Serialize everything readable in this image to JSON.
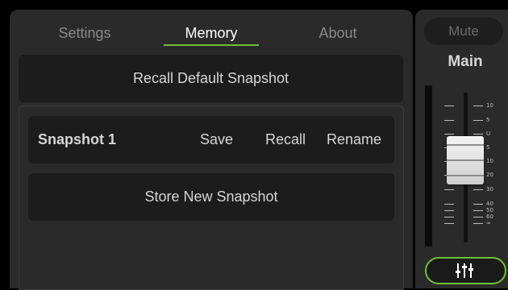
{
  "tabs": [
    {
      "label": "Settings",
      "active": false
    },
    {
      "label": "Memory",
      "active": true
    },
    {
      "label": "About",
      "active": false
    }
  ],
  "recall_default_label": "Recall Default Snapshot",
  "snapshots": [
    {
      "name": "Snapshot 1",
      "save_label": "Save",
      "recall_label": "Recall",
      "rename_label": "Rename"
    }
  ],
  "store_new_label": "Store New Snapshot",
  "channel": {
    "mute_label": "Mute",
    "name": "Main",
    "fader_scale": [
      "10",
      "5",
      "U",
      "5",
      "10",
      "20",
      "30",
      "40",
      "50",
      "60",
      "∞"
    ],
    "mixer_icon": "mixer-sliders-icon"
  },
  "colors": {
    "accent": "#6fc036",
    "panel": "#2a2a2a",
    "button": "#1c1c1c",
    "background": "#000000"
  }
}
